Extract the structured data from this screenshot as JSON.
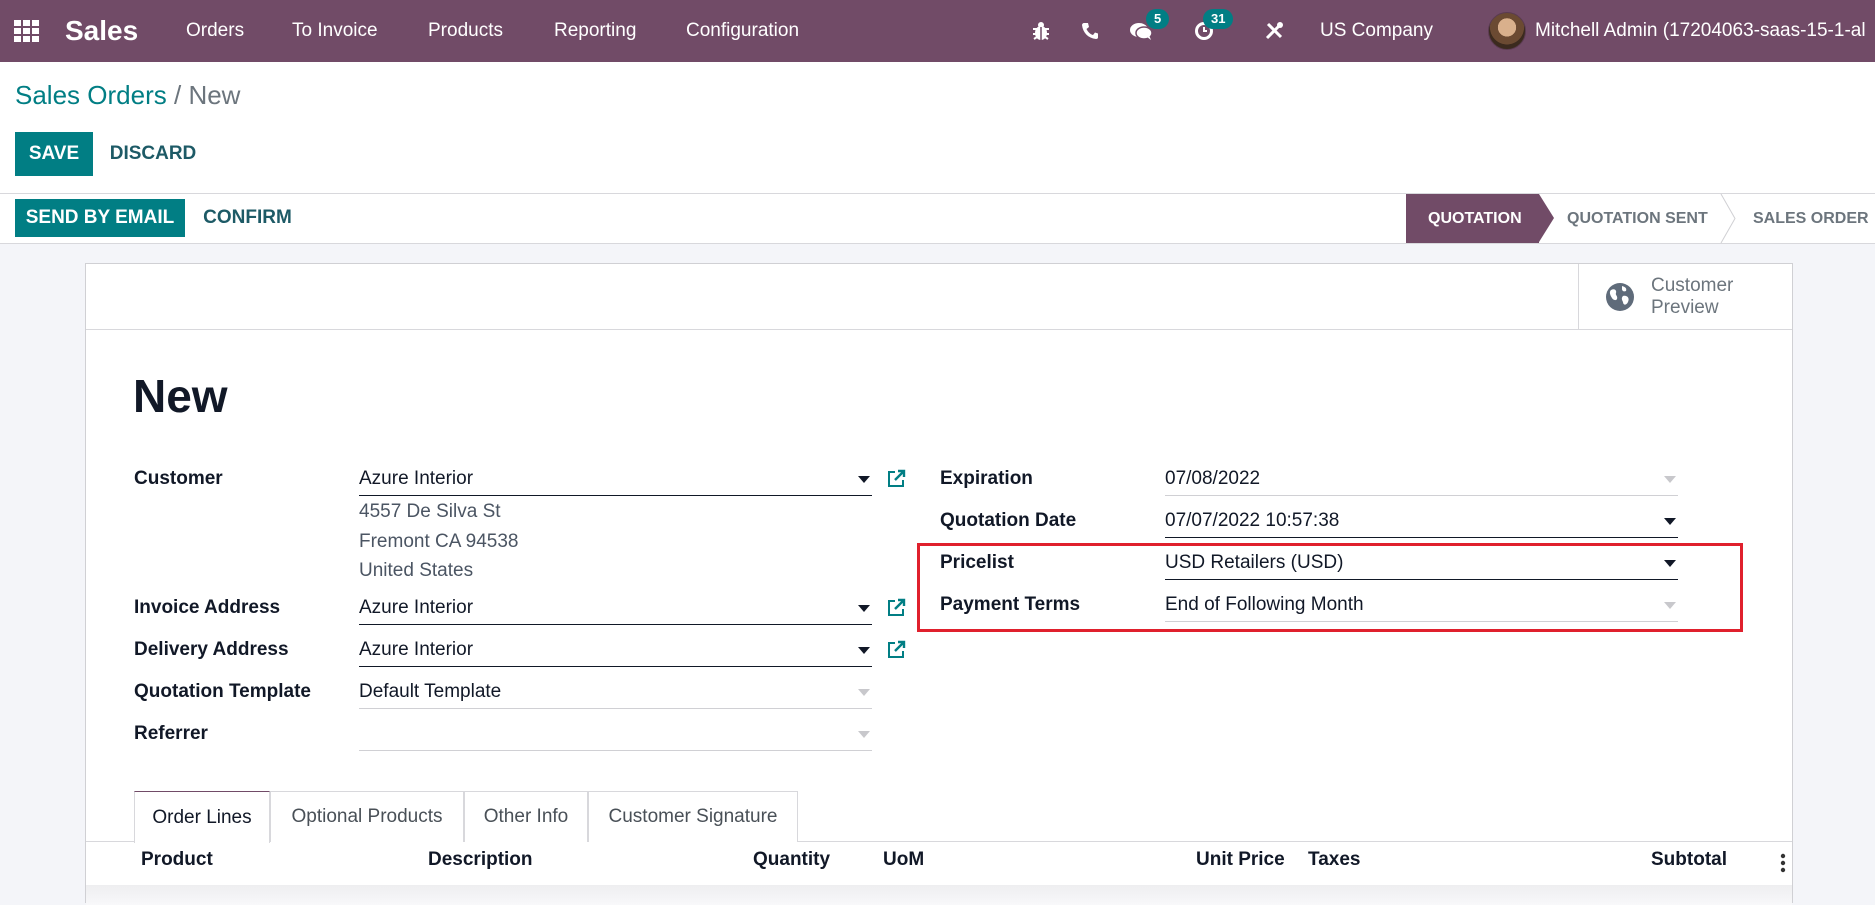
{
  "navbar": {
    "apps_icon": "apps-grid-icon",
    "app_name": "Sales",
    "menu": [
      "Orders",
      "To Invoice",
      "Products",
      "Reporting",
      "Configuration"
    ],
    "systray": {
      "debug_icon": "bug-icon",
      "phone_icon": "phone-icon",
      "messages_icon": "chat-icon",
      "messages_count": "5",
      "activity_icon": "clock-icon",
      "activity_count": "31",
      "tools_icon": "tools-icon",
      "company": "US Company",
      "user_name": "Mitchell Admin (17204063-saas-15-1-al"
    }
  },
  "breadcrumb": {
    "parent": "Sales Orders",
    "separator": "/",
    "current": "New"
  },
  "control_buttons": {
    "save": "SAVE",
    "discard": "DISCARD"
  },
  "header_buttons": {
    "send_by_email": "SEND BY EMAIL",
    "confirm": "CONFIRM"
  },
  "statusbar": {
    "steps": [
      "QUOTATION",
      "QUOTATION SENT",
      "SALES ORDER"
    ],
    "active": "QUOTATION"
  },
  "button_box": {
    "customer_preview": [
      "Customer",
      "Preview"
    ],
    "icon": "globe-icon"
  },
  "form": {
    "title": "New",
    "left": {
      "customer": {
        "label": "Customer",
        "value": "Azure Interior",
        "address": [
          "4557 De Silva St",
          "Fremont CA 94538",
          "United States"
        ]
      },
      "invoice_address": {
        "label": "Invoice Address",
        "value": "Azure Interior"
      },
      "delivery_address": {
        "label": "Delivery Address",
        "value": "Azure Interior"
      },
      "quotation_template": {
        "label": "Quotation Template",
        "value": "Default Template"
      },
      "referrer": {
        "label": "Referrer",
        "value": ""
      }
    },
    "right": {
      "expiration": {
        "label": "Expiration",
        "value": "07/08/2022"
      },
      "quotation_date": {
        "label": "Quotation Date",
        "value": "07/07/2022 10:57:38"
      },
      "pricelist": {
        "label": "Pricelist",
        "value": "USD Retailers (USD)"
      },
      "payment_terms": {
        "label": "Payment Terms",
        "value": "End of Following Month"
      }
    }
  },
  "tabs": [
    "Order Lines",
    "Optional Products",
    "Other Info",
    "Customer Signature"
  ],
  "active_tab": "Order Lines",
  "order_lines": {
    "columns": [
      "Product",
      "Description",
      "Quantity",
      "UoM",
      "Unit Price",
      "Taxes",
      "Subtotal"
    ],
    "rows": []
  },
  "colors": {
    "brand": "#714b67",
    "primary": "#017e84",
    "highlight": "#e0202d"
  }
}
